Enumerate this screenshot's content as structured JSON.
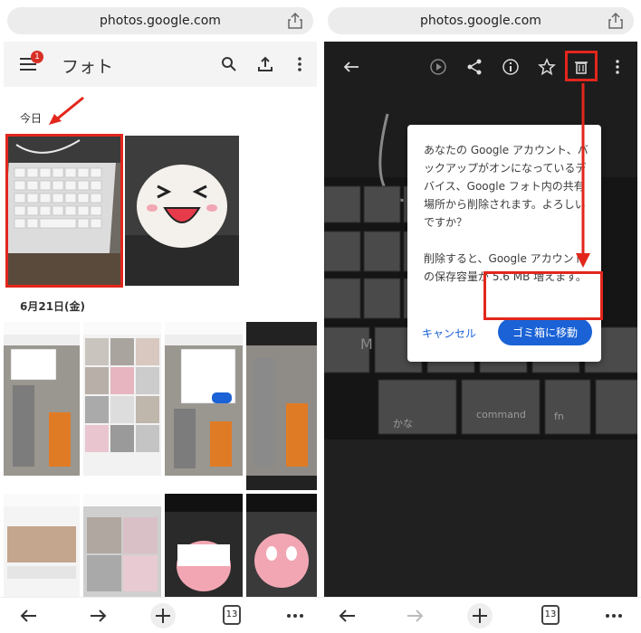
{
  "left": {
    "browser": {
      "url": "photos.google.com"
    },
    "header": {
      "title": "フォト",
      "badge_count": "1"
    },
    "sections": [
      {
        "label": "今日"
      },
      {
        "label": "6月21日(金)"
      }
    ],
    "toolbar": {
      "tab_count": "13"
    }
  },
  "right": {
    "browser": {
      "url": "photos.google.com"
    },
    "dialog": {
      "message": "あなたの Google アカウント、バックアップがオンになっているデバイス、Google フォト内の共有場所から削除されます。よろしいですか？",
      "storage_note": "削除すると、Google アカウントの保存容量が 5.6 MB 増えます。",
      "cancel_label": "キャンセル",
      "confirm_label": "ゴミ箱に移動"
    },
    "keyboard_keys": [
      "command",
      "fn",
      "かな"
    ],
    "toolbar": {
      "tab_count": "13"
    }
  },
  "colors": {
    "accent": "#1a62d6",
    "highlight": "#e3261c",
    "badge": "#d93025"
  }
}
